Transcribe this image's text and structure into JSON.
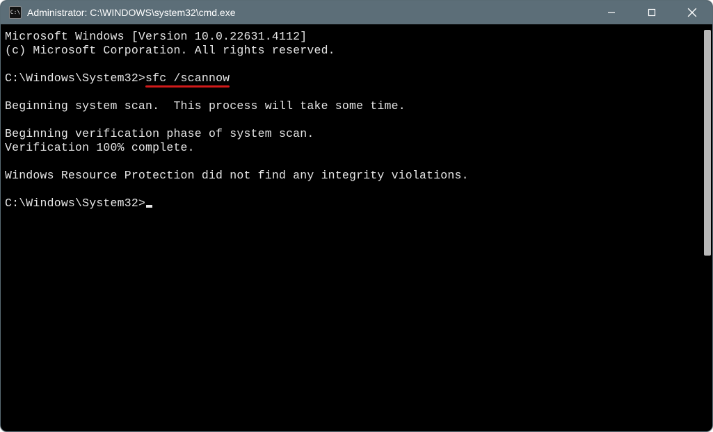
{
  "title": "Administrator: C:\\WINDOWS\\system32\\cmd.exe",
  "cmd_icon_text": "C:\\",
  "console": {
    "line1": "Microsoft Windows [Version 10.0.22631.4112]",
    "line2": "(c) Microsoft Corporation. All rights reserved.",
    "prompt1_prefix": "C:\\Windows\\System32>",
    "prompt1_cmd": "sfc /scannow",
    "line3": "Beginning system scan.  This process will take some time.",
    "line4": "Beginning verification phase of system scan.",
    "line5": "Verification 100% complete.",
    "line6": "Windows Resource Protection did not find any integrity violations.",
    "prompt2": "C:\\Windows\\System32>"
  }
}
